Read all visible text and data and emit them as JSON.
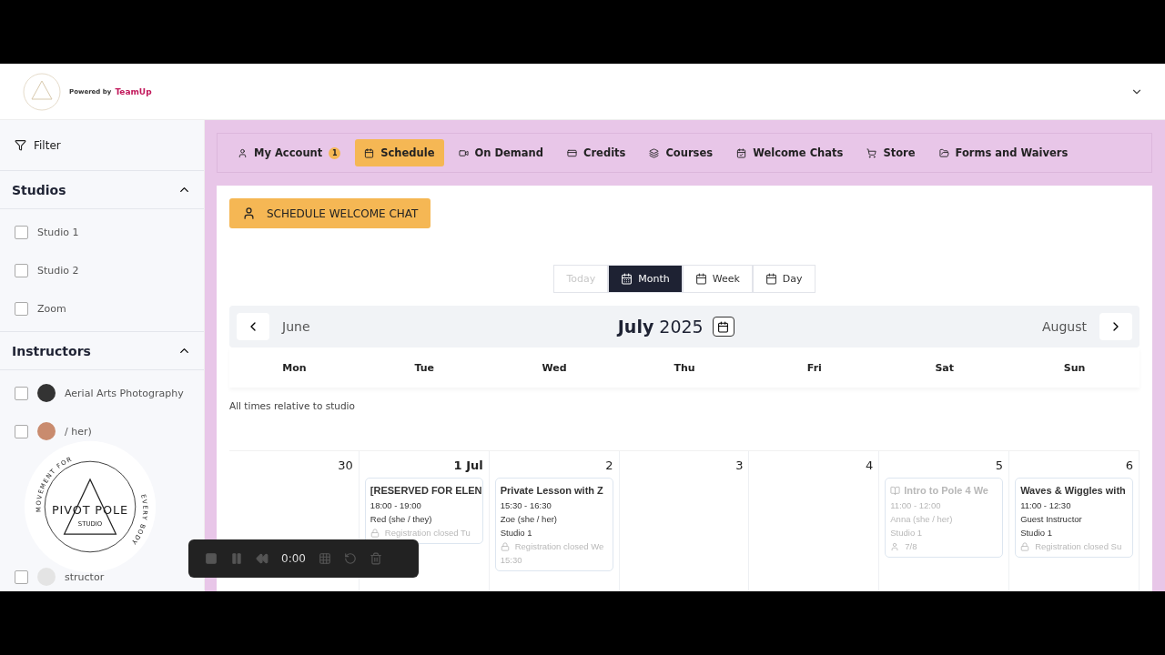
{
  "header": {
    "powered_by": "Powered by",
    "brand": "TeamUp"
  },
  "sidebar": {
    "filter": "Filter",
    "sections": [
      {
        "title": "Studios",
        "expanded": true,
        "items": [
          {
            "label": "Studio 1",
            "checked": false
          },
          {
            "label": "Studio 2",
            "checked": false
          },
          {
            "label": "Zoom",
            "checked": false
          }
        ]
      },
      {
        "title": "Instructors",
        "expanded": true,
        "items": [
          {
            "label": "Aerial Arts Photography",
            "checked": false,
            "avatar": true
          },
          {
            "label": "/ her)",
            "checked": false,
            "avatar": true
          },
          {
            "label": "structor",
            "checked": false,
            "avatar": true
          }
        ]
      }
    ]
  },
  "logo_overlay": {
    "top": "MOVEMENT FOR",
    "right": "EVERY BODY",
    "name": "PIVOT POLE",
    "sub": "STUDIO"
  },
  "nav": [
    {
      "label": "My Account",
      "badge": "1",
      "selected": false
    },
    {
      "label": "Schedule",
      "selected": true
    },
    {
      "label": "On Demand",
      "selected": false
    },
    {
      "label": "Credits",
      "selected": false
    },
    {
      "label": "Courses",
      "selected": false
    },
    {
      "label": "Welcome Chats",
      "selected": false
    },
    {
      "label": "Store",
      "selected": false
    },
    {
      "label": "Forms and Waivers",
      "selected": false
    }
  ],
  "cta": "SCHEDULE WELCOME CHAT",
  "view": {
    "today": "Today",
    "today_disabled": true,
    "modes": [
      {
        "label": "Month",
        "selected": true
      },
      {
        "label": "Week",
        "selected": false
      },
      {
        "label": "Day",
        "selected": false
      }
    ]
  },
  "month_nav": {
    "prev": "June",
    "month": "July",
    "year": "2025",
    "next": "August"
  },
  "weekdays": [
    "Mon",
    "Tue",
    "Wed",
    "Thu",
    "Fri",
    "Sat",
    "Sun"
  ],
  "note": "All times relative to studio",
  "days": [
    {
      "date": "30",
      "bold": false
    },
    {
      "date": "1 Jul",
      "bold": true,
      "events": [
        {
          "title": "[RESERVED FOR ELEN",
          "time": "18:00 - 19:00",
          "instructor": "Red (she / they)",
          "status": "Registration closed  Tu",
          "disabled": false
        }
      ]
    },
    {
      "date": "2",
      "bold": false,
      "events": [
        {
          "title": "Private Lesson with Z",
          "time": "15:30 - 16:30",
          "instructor": "Zoe (she / her)",
          "room": "Studio 1",
          "status": "Registration closed  We",
          "status2": "15:30",
          "disabled": false
        }
      ]
    },
    {
      "date": "3",
      "bold": false
    },
    {
      "date": "4",
      "bold": false
    },
    {
      "date": "5",
      "bold": false,
      "events": [
        {
          "title": "Intro to Pole 4 We",
          "course": true,
          "time": "11:00 - 12:00",
          "instructor": "Anna (she / her)",
          "room": "Studio 1",
          "capacity": "7/8",
          "disabled": true
        }
      ]
    },
    {
      "date": "6",
      "bold": false,
      "events": [
        {
          "title": "Waves & Wiggles with",
          "time": "11:00 - 12:30",
          "instructor": "Guest Instructor",
          "room": "Studio 1",
          "status": "Registration closed  Su",
          "disabled": false
        }
      ]
    }
  ],
  "recorder": {
    "time": "0:00"
  }
}
